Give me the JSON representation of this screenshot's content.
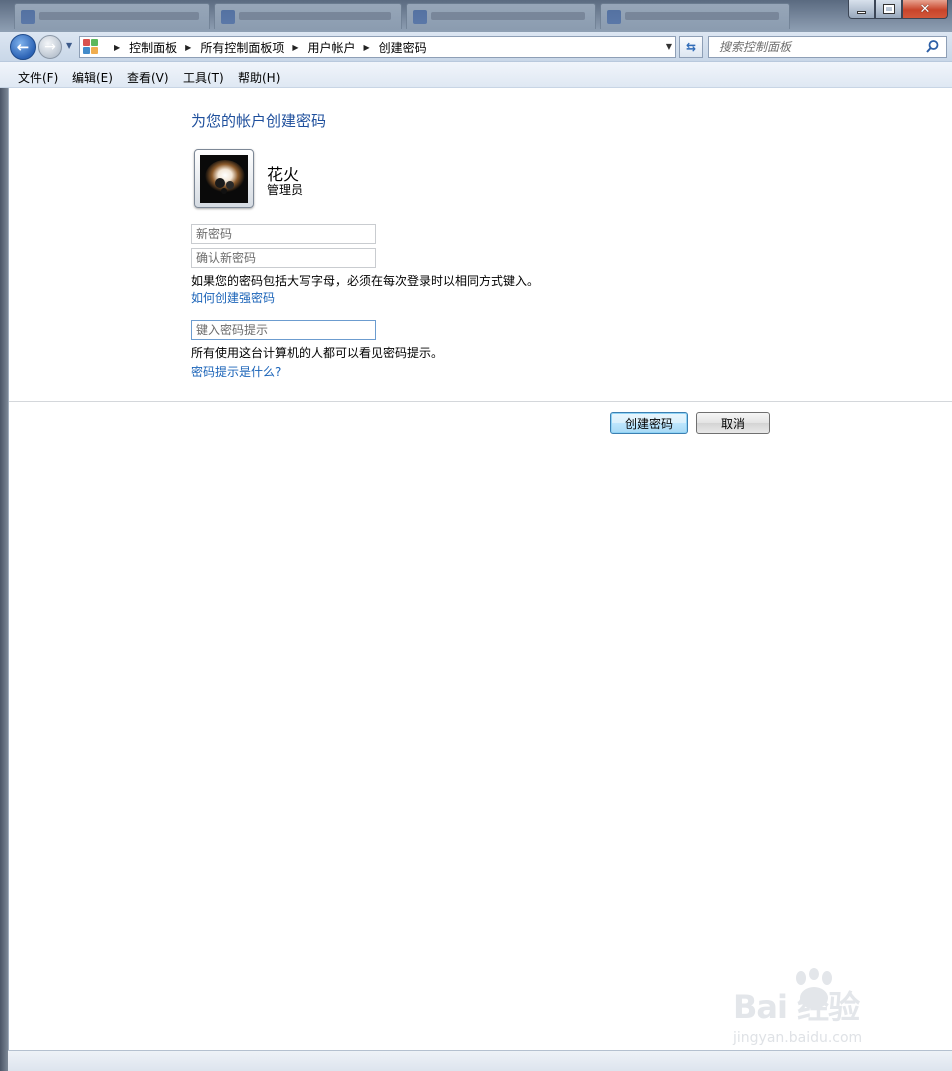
{
  "window": {
    "minimize_glyph": "minimize-icon",
    "maximize_glyph": "maximize-icon",
    "close_glyph": "✕"
  },
  "navigation": {
    "back_icon": "back-arrow-icon",
    "forward_icon": "forward-arrow-icon",
    "breadcrumb": [
      "控制面板",
      "所有控制面板项",
      "用户帐户",
      "创建密码"
    ],
    "search_placeholder": "搜索控制面板"
  },
  "menu": [
    {
      "label": "文件(F)"
    },
    {
      "label": "编辑(E)"
    },
    {
      "label": "查看(V)"
    },
    {
      "label": "工具(T)"
    },
    {
      "label": "帮助(H)"
    }
  ],
  "page": {
    "title": "为您的帐户创建密码",
    "user": {
      "name": "花火",
      "role": "管理员"
    },
    "new_password_placeholder": "新密码",
    "confirm_password_placeholder": "确认新密码",
    "case_note": "如果您的密码包括大写字母，必须在每次登录时以相同方式键入。",
    "strong_password_link": "如何创建强密码",
    "hint_placeholder": "键入密码提示",
    "hint_note": "所有使用这台计算机的人都可以看见密码提示。",
    "hint_help_link": "密码提示是什么?",
    "create_button": "创建密码",
    "cancel_button": "取消"
  },
  "watermark": {
    "brand": "Bai  经验",
    "url": "jingyan.baidu.com"
  },
  "colors": {
    "title_blue": "#1e4f9c",
    "link_blue": "#1a63b8",
    "close_red": "#c8452b"
  }
}
